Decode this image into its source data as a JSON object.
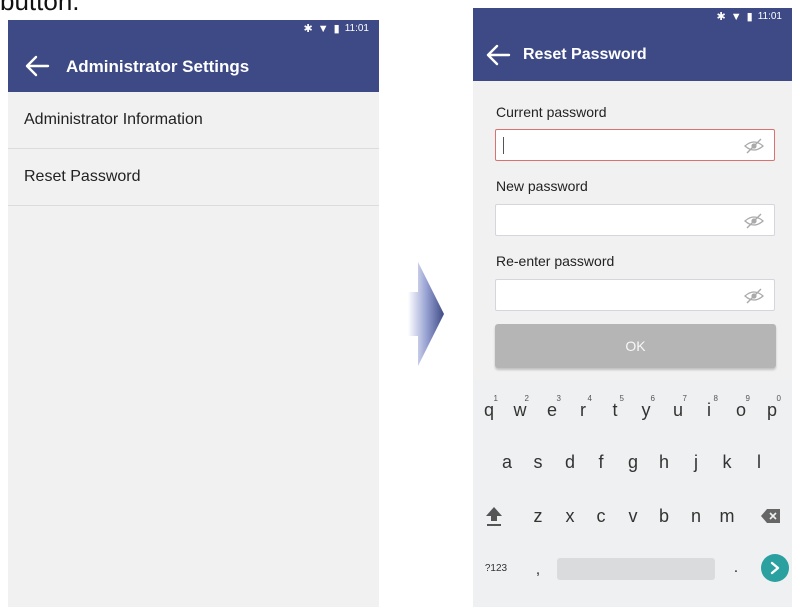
{
  "caption": "button.",
  "left_screen": {
    "status": {
      "time": "11:01",
      "icons": [
        "bluetooth-icon",
        "wifi-icon",
        "battery-icon"
      ]
    },
    "title": "Administrator Settings",
    "menu_items": [
      {
        "label": "Administrator Information"
      },
      {
        "label": "Reset Password"
      }
    ]
  },
  "right_screen": {
    "status": {
      "time": "11:01",
      "icons": [
        "bluetooth-icon",
        "wifi-icon",
        "battery-icon"
      ]
    },
    "title": "Reset Password",
    "fields": [
      {
        "label": "Current password",
        "value": "",
        "focused": true
      },
      {
        "label": "New password",
        "value": "",
        "focused": false
      },
      {
        "label": "Re-enter password",
        "value": "",
        "focused": false
      }
    ],
    "ok_label": "OK",
    "keyboard": {
      "row1": [
        "q",
        "w",
        "e",
        "r",
        "t",
        "y",
        "u",
        "i",
        "o",
        "p"
      ],
      "row1_hints": [
        "1",
        "2",
        "3",
        "4",
        "5",
        "6",
        "7",
        "8",
        "9",
        "0"
      ],
      "row2": [
        "a",
        "s",
        "d",
        "f",
        "g",
        "h",
        "j",
        "k",
        "l"
      ],
      "row3": [
        "z",
        "x",
        "c",
        "v",
        "b",
        "n",
        "m"
      ],
      "symbols_label": "?123",
      "comma": ",",
      "period": "."
    }
  },
  "colors": {
    "appbar": "#3e4a85",
    "focus_border": "#d9736f",
    "enter_key": "#2ba0a0",
    "ok_disabled": "#b5b5b5"
  }
}
